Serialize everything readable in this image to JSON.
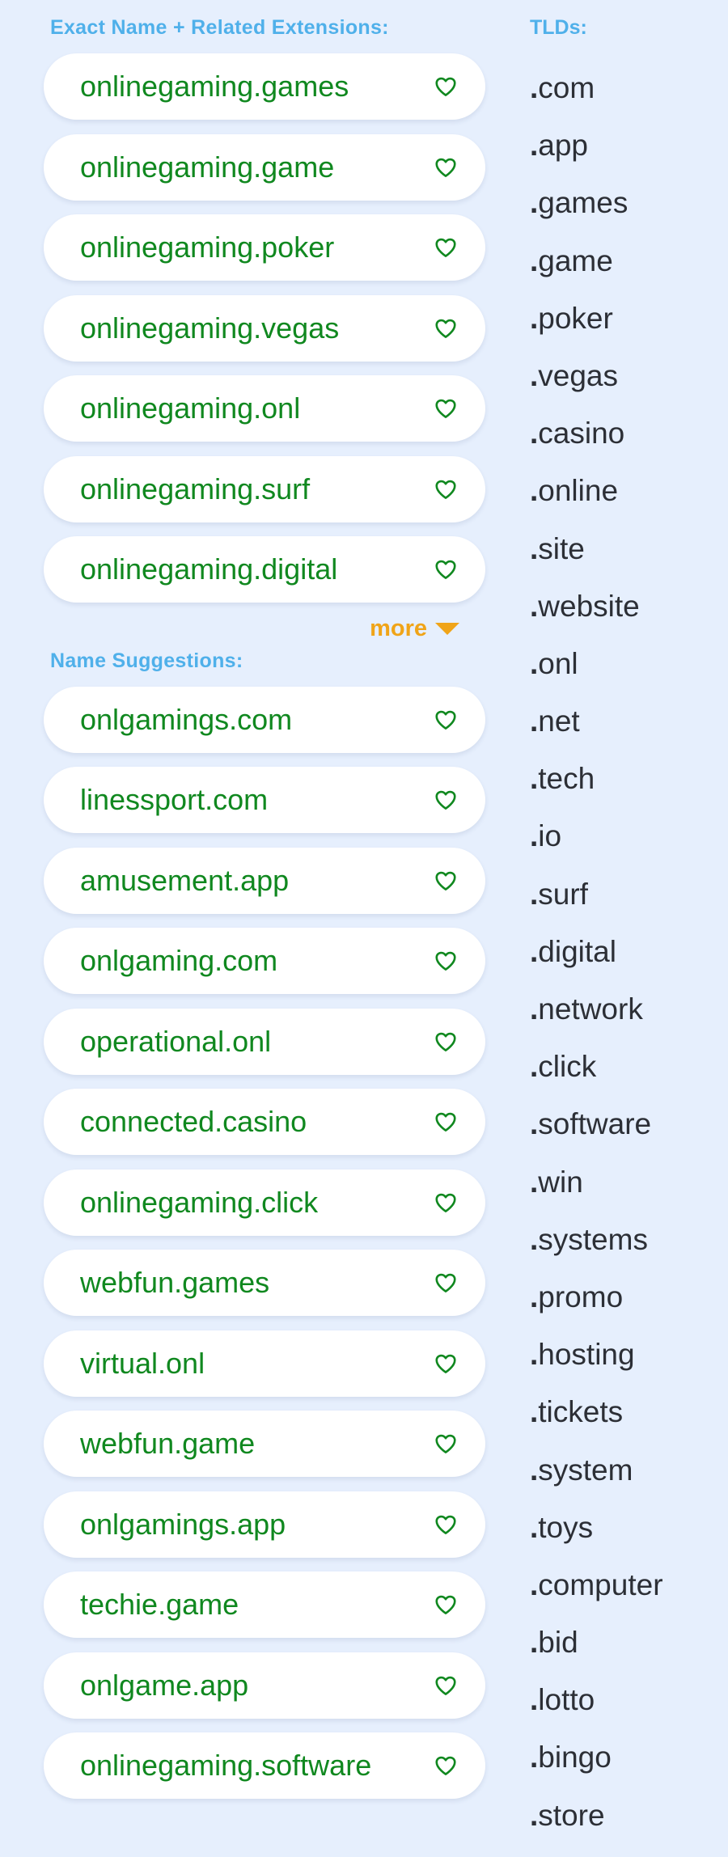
{
  "exact_section": {
    "title": "Exact Name + Related Extensions:",
    "domains": [
      "online​gaming.games",
      "online​gaming.game",
      "online​gaming.poker",
      "online​gaming.vegas",
      "online​gaming.onl",
      "online​gaming.surf",
      "online​gaming.digital"
    ],
    "more_label": "more"
  },
  "suggest_section": {
    "title": "Name Suggestions:",
    "domains": [
      "onl​gamings.com",
      "lines​sport.com",
      "amusement.app",
      "onl​gaming.com",
      "operational.onl",
      "connected.casino",
      "online​gaming.click",
      "web​fun.games",
      "virtual.onl",
      "web​fun.game",
      "onl​gamings.app",
      "techie.game",
      "onl​game.app",
      "online​gaming.software"
    ]
  },
  "tld_section": {
    "title": "TLDs:",
    "items": [
      "com",
      "app",
      "games",
      "game",
      "poker",
      "vegas",
      "casino",
      "online",
      "site",
      "website",
      "onl",
      "net",
      "tech",
      "io",
      "surf",
      "digital",
      "network",
      "click",
      "software",
      "win",
      "systems",
      "promo",
      "hosting",
      "tickets",
      "system",
      "toys",
      "computer",
      "bid",
      "lotto",
      "bingo",
      "store"
    ]
  },
  "colors": {
    "background": "#e6effd",
    "heading": "#4fb0ea",
    "domain_text": "#10881f",
    "heart": "#10881f",
    "more": "#f0a418",
    "tld_text": "#2c2f36"
  },
  "icons": {
    "favorite": "heart-outline-icon",
    "more": "caret-down-icon"
  }
}
